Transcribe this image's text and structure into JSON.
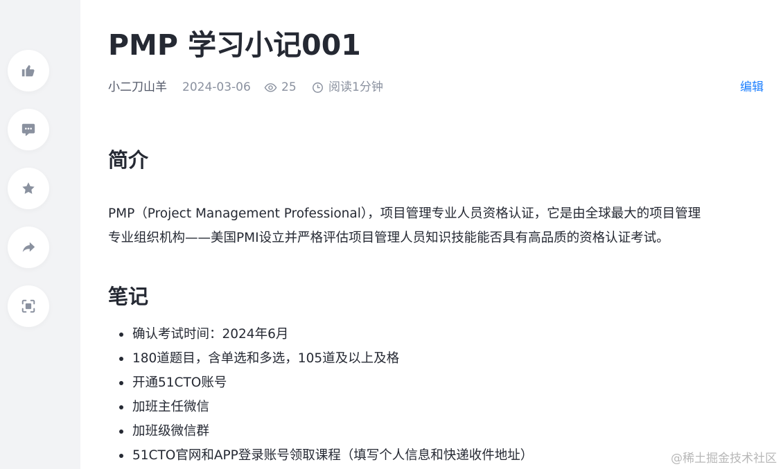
{
  "rail": {
    "buttons": [
      {
        "icon": "thumbs-up-icon"
      },
      {
        "icon": "comment-icon"
      },
      {
        "icon": "star-icon"
      },
      {
        "icon": "share-icon"
      },
      {
        "icon": "focus-mode-icon"
      }
    ],
    "icon_color": "#8a919f",
    "background": "#f2f3f5"
  },
  "article": {
    "title": "PMP 学习小记001",
    "meta": {
      "author": "小二刀山羊",
      "date": "2024-03-06",
      "views": "25",
      "read_time": "阅读1分钟",
      "edit_label": "编辑"
    },
    "sections": {
      "intro": {
        "heading": "简介",
        "lines": [
          "PMP（Project Management Professional），项目管理专业人员资格认证，它是由全球最大的项目管理",
          "专业组织机构——美国PMI设立并严格评估项目管理人员知识技能能否具有高品质的资格认证考试。"
        ]
      },
      "notes": {
        "heading": "笔记",
        "items": [
          "确认考试时间：2024年6月",
          "180道题目，含单选和多选，105道及以上及格",
          "开通51CTO账号",
          "加班主任微信",
          "加班级微信群",
          "51CTO官网和APP登录账号领取课程（填写个人信息和快递收件地址）"
        ]
      }
    }
  },
  "watermark": "@稀土掘金技术社区",
  "colors": {
    "accent": "#1e80ff",
    "text": "#252933",
    "muted": "#8a919f"
  }
}
